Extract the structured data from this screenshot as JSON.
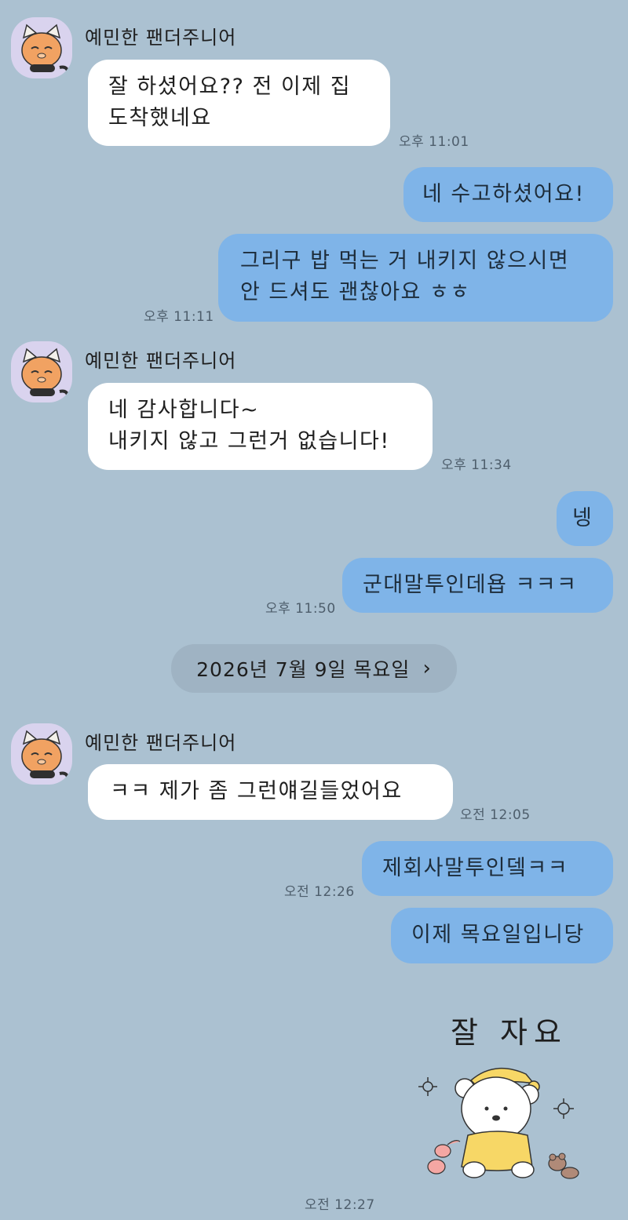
{
  "messages": [
    {
      "sender": "예민한 팬더주니어",
      "lines": [
        "잘 하셨어요?? 전 이제 집",
        "도착했네요"
      ],
      "time": "오후 11:01"
    },
    {
      "text": "네 수고하셨어요!"
    },
    {
      "lines": [
        "그리구 밥 먹는 거 내키지 않으시면",
        "안 드셔도 괜찮아요 ㅎㅎ"
      ],
      "time": "오후 11:11"
    },
    {
      "sender": "예민한 팬더주니어",
      "lines": [
        "네 감사합니다~",
        "내키지 않고 그런거 없습니다!"
      ],
      "time": "오후 11:34"
    },
    {
      "text": "넹"
    },
    {
      "text": "군대말투인데욥 ㅋㅋㅋ",
      "time": "오후 11:50"
    },
    {
      "sender": "예민한 팬더주니어",
      "text": "ㅋㅋ 제가 좀 그런얘길들었어요",
      "time": "오전 12:05"
    },
    {
      "text": "제회사말투인뎈ㅋㅋ",
      "time": "오전 12:26"
    },
    {
      "text": "이제 목요일입니당"
    }
  ],
  "date_divider": {
    "label": "2026년 7월 9일 목요일",
    "arrow": "›"
  },
  "sticker": {
    "caption": "잘 자요",
    "time": "오전 12:27",
    "icon": "sleeping-bear-sticker"
  },
  "avatar_icon": "red-panda-avatar",
  "colors": {
    "background": "#abc1d1",
    "incoming_bubble": "#ffffff",
    "outgoing_bubble": "#7fb4e8",
    "avatar_bg": "#d9d3ee",
    "date_pill": "#9fb3c3"
  }
}
